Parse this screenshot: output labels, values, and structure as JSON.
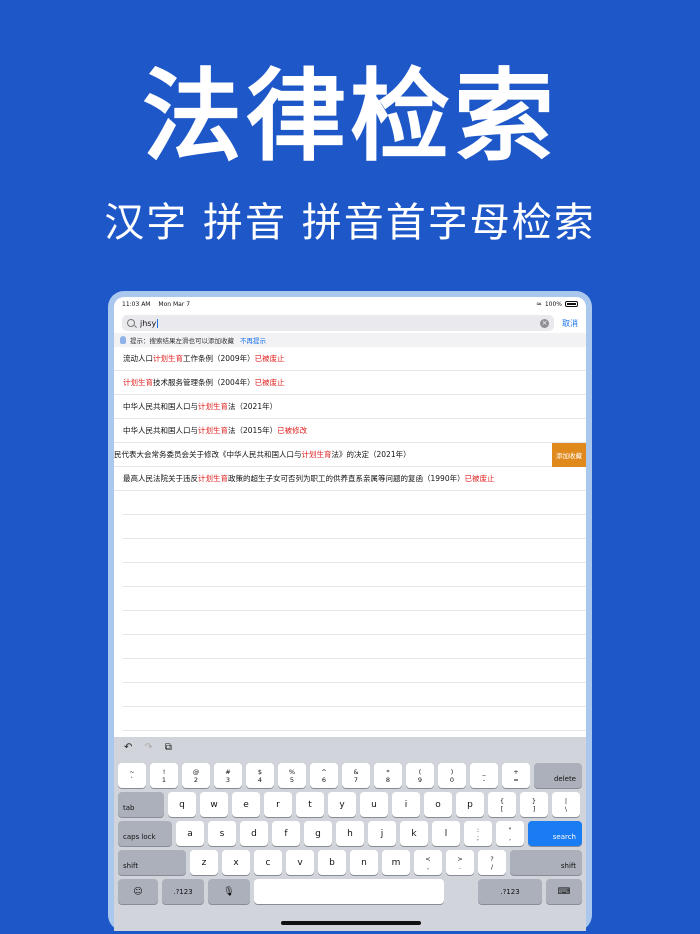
{
  "hero": {
    "title": "法律检索",
    "subtitle": "汉字 拼音 拼音首字母检索"
  },
  "status_bar": {
    "time": "11:03 AM",
    "date": "Mon Mar 7",
    "battery": "100%"
  },
  "search": {
    "value": "jhsy",
    "cancel_label": "取消"
  },
  "hint": {
    "text": "提示：搜索结果左滑也可以添加收藏",
    "action": "不再提示"
  },
  "results": [
    {
      "parts": [
        "流动人口",
        "计划生育",
        "工作条例（2009年）",
        "已被废止"
      ]
    },
    {
      "parts": [
        "",
        "计划生育",
        "技术服务管理条例（2004年）",
        "已被废止"
      ]
    },
    {
      "parts": [
        "中华人民共和国人口与",
        "计划生育",
        "法（2021年）",
        ""
      ]
    },
    {
      "parts": [
        "中华人民共和国人口与",
        "计划生育",
        "法（2015年）",
        "已被修改"
      ]
    },
    {
      "parts": [
        "民代表大会常务委员会关于修改《中华人民共和国人口与",
        "计划生育",
        "法》的决定（2021年）",
        ""
      ],
      "swipe_action": "添加收藏"
    },
    {
      "parts": [
        "最高人民法院关于违反",
        "计划生育",
        "政策的超生子女可否列为职工的供养直系亲属等问题的复函（1990年）",
        "已被废止"
      ]
    }
  ],
  "keyboard": {
    "row1": [
      {
        "top": "~",
        "bottom": "`"
      },
      {
        "top": "!",
        "bottom": "1"
      },
      {
        "top": "@",
        "bottom": "2"
      },
      {
        "top": "#",
        "bottom": "3"
      },
      {
        "top": "$",
        "bottom": "4"
      },
      {
        "top": "%",
        "bottom": "5"
      },
      {
        "top": "^",
        "bottom": "6"
      },
      {
        "top": "&",
        "bottom": "7"
      },
      {
        "top": "*",
        "bottom": "8"
      },
      {
        "top": "(",
        "bottom": "9"
      },
      {
        "top": ")",
        "bottom": "0"
      },
      {
        "top": "_",
        "bottom": "-"
      },
      {
        "top": "+",
        "bottom": "="
      }
    ],
    "delete": "delete",
    "tab": "tab",
    "row2": [
      "q",
      "w",
      "e",
      "r",
      "t",
      "y",
      "u",
      "i",
      "o",
      "p"
    ],
    "row2_sym": [
      {
        "top": "{",
        "bottom": "["
      },
      {
        "top": "}",
        "bottom": "]"
      },
      {
        "top": "|",
        "bottom": "\\"
      }
    ],
    "caps": "caps lock",
    "row3": [
      "a",
      "s",
      "d",
      "f",
      "g",
      "h",
      "j",
      "k",
      "l"
    ],
    "row3_sym": [
      {
        "top": ":",
        "bottom": ";"
      },
      {
        "top": "\"",
        "bottom": ","
      }
    ],
    "search": "search",
    "shift": "shift",
    "row4": [
      "z",
      "x",
      "c",
      "v",
      "b",
      "n",
      "m"
    ],
    "row4_sym": [
      {
        "top": "<",
        "bottom": ","
      },
      {
        "top": ">",
        "bottom": "."
      },
      {
        "top": "?",
        "bottom": "/"
      }
    ],
    "num_label": ".?123"
  }
}
